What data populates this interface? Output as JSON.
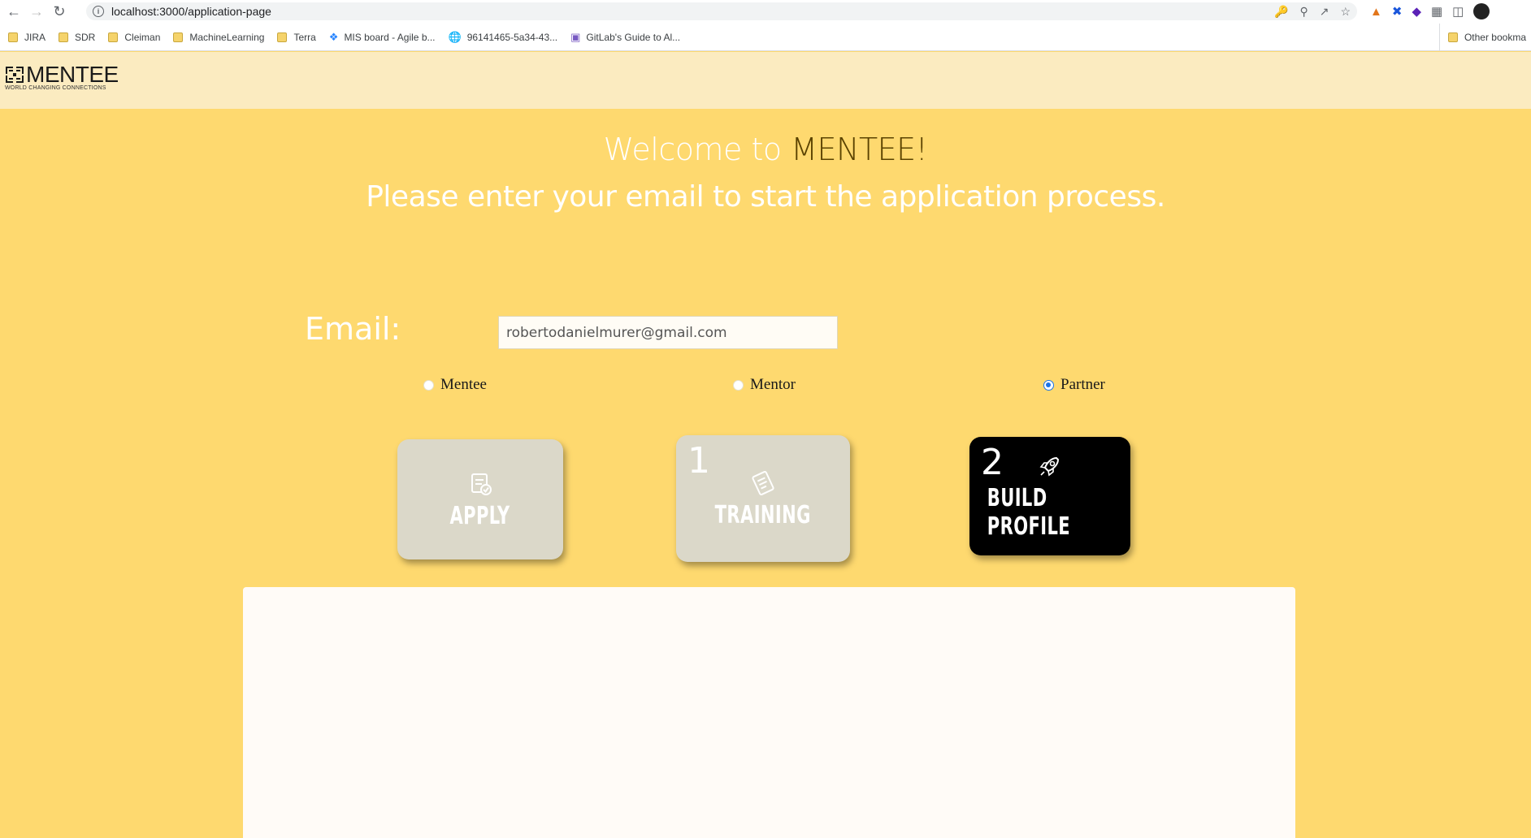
{
  "browser": {
    "url": "localhost:3000/application-page",
    "bookmarks": [
      {
        "label": "JIRA",
        "icon": "folder-icon"
      },
      {
        "label": "SDR",
        "icon": "folder-icon"
      },
      {
        "label": "Cleiman",
        "icon": "folder-icon"
      },
      {
        "label": "MachineLearning",
        "icon": "folder-icon"
      },
      {
        "label": "Terra",
        "icon": "folder-icon"
      },
      {
        "label": "MIS board - Agile b...",
        "icon": "jira-icon"
      },
      {
        "label": "96141465-5a34-43...",
        "icon": "globe-icon"
      },
      {
        "label": "GitLab's Guide to Al...",
        "icon": "gitlab-icon"
      }
    ],
    "other_bookmarks": "Other bookma"
  },
  "header": {
    "logo_text": "MENTEE",
    "logo_tagline": "WORLD CHANGING CONNECTIONS"
  },
  "welcome": {
    "prefix": "Welcome to ",
    "brand": "MENTEE!",
    "subtitle": "Please enter your email to start the application process."
  },
  "form": {
    "email_label": "Email:",
    "email_value": "robertodanielmurer@gmail.com",
    "roles": [
      {
        "label": "Mentee",
        "checked": false
      },
      {
        "label": "Mentor",
        "checked": false
      },
      {
        "label": "Partner",
        "checked": true
      }
    ]
  },
  "steps": [
    {
      "number": "",
      "label": "APPLY",
      "icon": "document-check-icon",
      "active": false
    },
    {
      "number": "1",
      "label": "TRAINING",
      "icon": "notebook-icon",
      "active": false
    },
    {
      "number": "2",
      "label": "BUILD PROFILE",
      "icon": "rocket-icon",
      "active": true
    }
  ],
  "colors": {
    "page_bg": "#fed96f",
    "header_bg": "#fbebc0",
    "card_inactive": "#dbd8c9",
    "card_active": "#000000",
    "radio_accent": "#1a73e8"
  }
}
